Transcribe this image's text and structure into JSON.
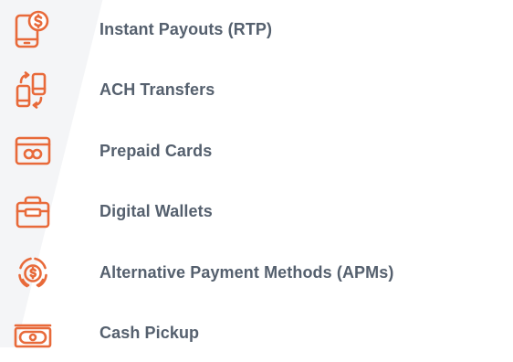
{
  "colors": {
    "accent": "#e86a3a",
    "text": "#55606e"
  },
  "payout_methods": [
    {
      "label": "Instant Payouts (RTP)",
      "icon": "phone-dollar-icon"
    },
    {
      "label": "ACH Transfers",
      "icon": "device-transfer-icon"
    },
    {
      "label": "Prepaid Cards",
      "icon": "card-icon"
    },
    {
      "label": "Digital Wallets",
      "icon": "wallet-icon"
    },
    {
      "label": "Alternative Payment Methods (APMs)",
      "icon": "coin-cycle-icon"
    },
    {
      "label": "Cash Pickup",
      "icon": "banknote-icon"
    }
  ]
}
